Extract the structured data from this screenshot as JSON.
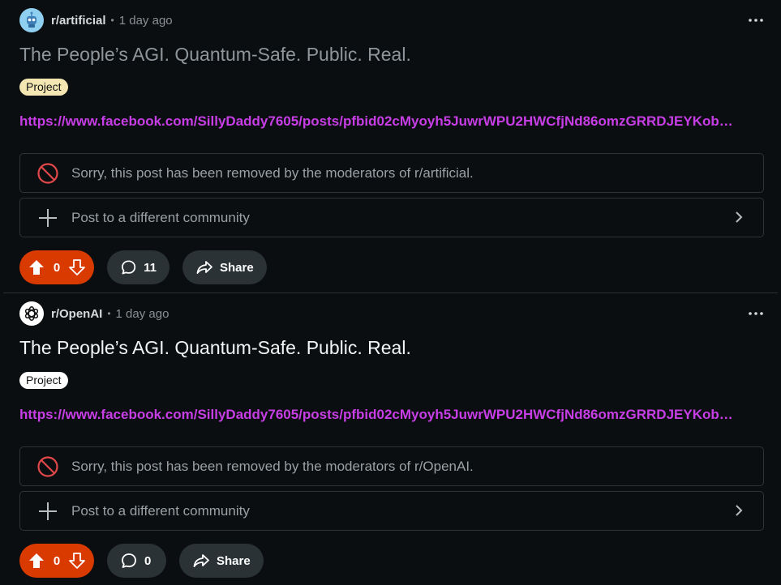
{
  "posts": [
    {
      "community": "r/artificial",
      "time": "1 day ago",
      "title": "The People’s AGI. Quantum-Safe. Public. Real.",
      "flair": "Project",
      "link": "https://www.facebook.com/SillyDaddy7605/posts/pfbid02cMyoyh5JuwrWPU2HWCfjNd86omzGRRDJEYKob…",
      "removed_notice": "Sorry, this post has been removed by the moderators of r/artificial.",
      "crosspost_label": "Post to a different community",
      "votes": "0",
      "comments": "11",
      "share_label": "Share"
    },
    {
      "community": "r/OpenAI",
      "time": "1 day ago",
      "title": "The People’s AGI. Quantum-Safe. Public. Real.",
      "flair": "Project",
      "link": "https://www.facebook.com/SillyDaddy7605/posts/pfbid02cMyoyh5JuwrWPU2HWCfjNd86omzGRRDJEYKob…",
      "removed_notice": "Sorry, this post has been removed by the moderators of r/OpenAI.",
      "crosspost_label": "Post to a different community",
      "votes": "0",
      "comments": "0",
      "share_label": "Share"
    }
  ],
  "meta_separator": "•",
  "colors": {
    "background": "#0b0e10",
    "vote_pill": "#d93a00",
    "link": "#c73ee6",
    "removed_icon": "#e0484a"
  }
}
